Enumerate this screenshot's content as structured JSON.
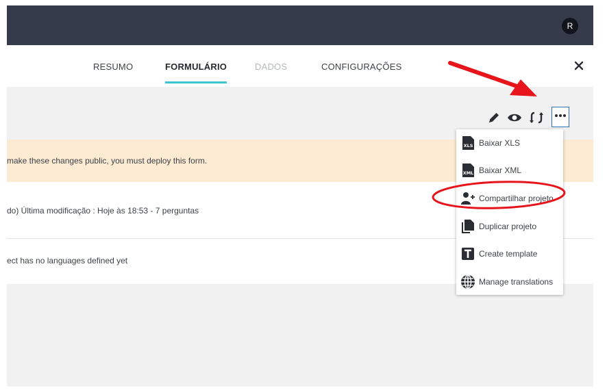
{
  "header": {
    "avatar_initial": "R"
  },
  "tabs": [
    {
      "label": "RESUMO",
      "state": "normal"
    },
    {
      "label": "FORMULÁRIO",
      "state": "active"
    },
    {
      "label": "DADOS",
      "state": "disabled"
    },
    {
      "label": "CONFIGURAÇÕES",
      "state": "normal"
    }
  ],
  "toolbar": {
    "icons": [
      "pencil-icon",
      "eye-icon",
      "sync-icon",
      "more-icon"
    ]
  },
  "warning": {
    "text": "make these changes public, you must deploy this form."
  },
  "info_rows": [
    {
      "text": "do) Última modificação : Hoje às 18:53 - 7 perguntas"
    },
    {
      "text": "ect has no languages defined yet"
    }
  ],
  "menu": {
    "items": [
      {
        "label": "Baixar XLS",
        "icon": "xls-file-icon"
      },
      {
        "label": "Baixar XML",
        "icon": "xml-file-icon"
      },
      {
        "label": "Compartilhar projeto",
        "icon": "add-user-icon"
      },
      {
        "label": "Duplicar projeto",
        "icon": "duplicate-icon"
      },
      {
        "label": "Create template",
        "icon": "template-icon"
      },
      {
        "label": "Manage translations",
        "icon": "globe-icon"
      }
    ]
  },
  "colors": {
    "topbar": "#363b4c",
    "tab_underline": "#3dc6d1",
    "warning_bg": "#fcebd3",
    "annotation_red": "#e8141b",
    "more_border": "#2f6fb3"
  }
}
